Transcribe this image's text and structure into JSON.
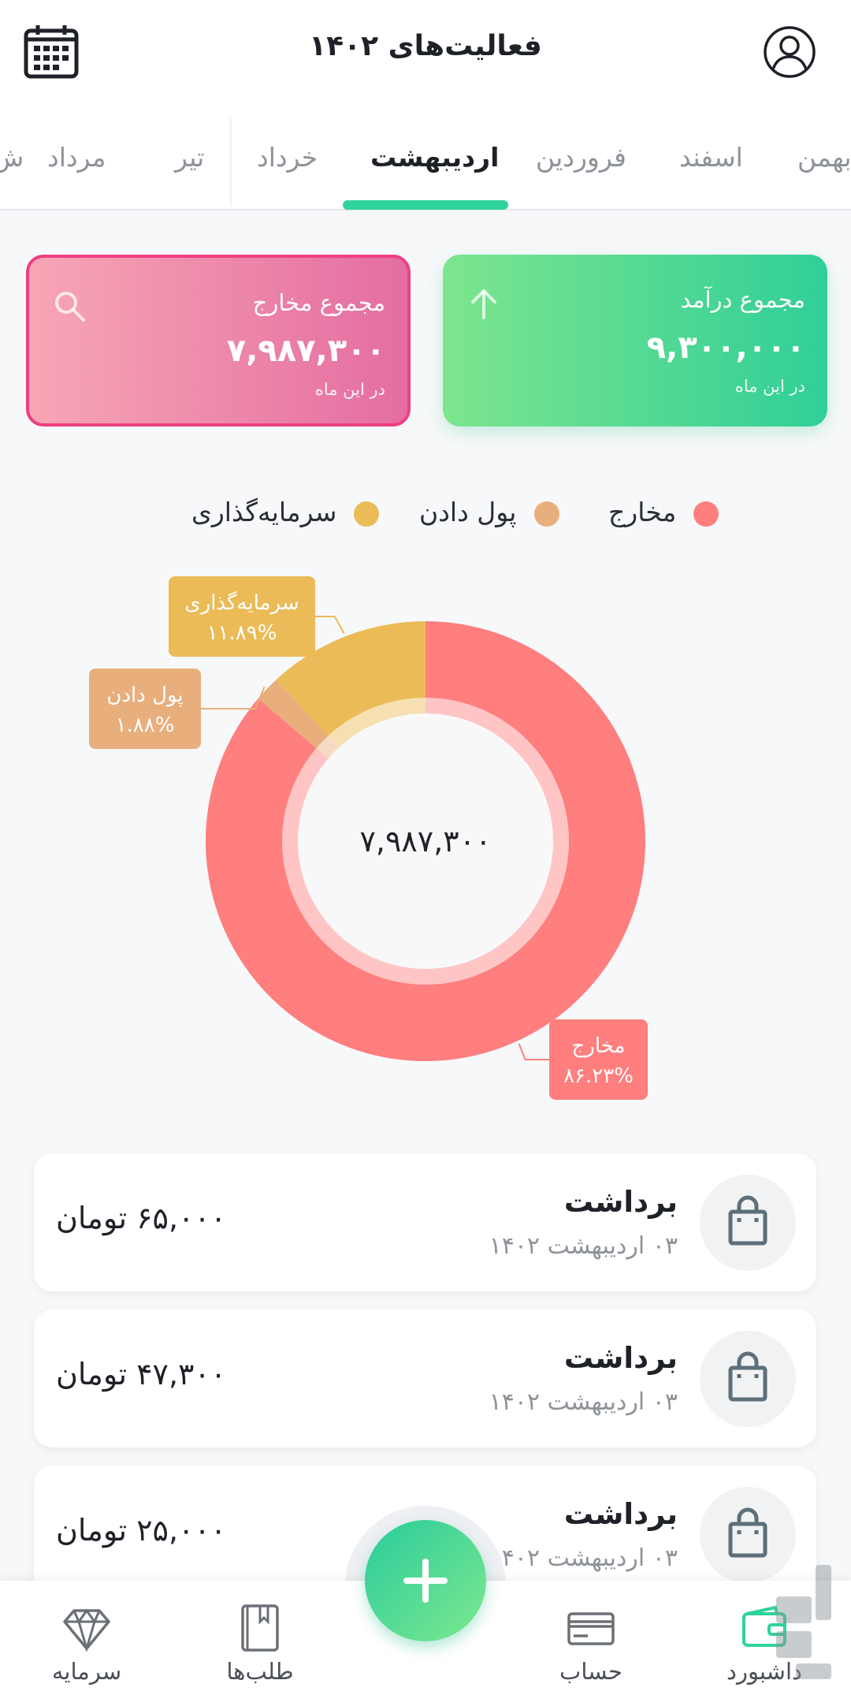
{
  "header": {
    "title": "فعالیت‌های ۱۴۰۲"
  },
  "tabs": [
    {
      "label": "بهمن",
      "active": false
    },
    {
      "label": "اسفند",
      "active": false
    },
    {
      "label": "فروردین",
      "active": false
    },
    {
      "label": "اردیبهشت",
      "active": true
    },
    {
      "label": "خرداد",
      "active": false
    },
    {
      "label": "تیر",
      "active": false
    },
    {
      "label": "مرداد",
      "active": false
    },
    {
      "label": "ش",
      "active": false
    }
  ],
  "summary": {
    "income": {
      "title": "مجموع درآمد",
      "amount": "۹,۳۰۰,۰۰۰",
      "sub": "در این ماه",
      "icon": "arrow-up-icon"
    },
    "expense": {
      "title": "مجموع مخارج",
      "amount": "۷,۹۸۷,۳۰۰",
      "sub": "در این ماه",
      "icon": "search-icon"
    }
  },
  "legend": [
    {
      "label": "مخارج",
      "color": "#ff7e7e"
    },
    {
      "label": "پول دادن",
      "color": "#e8ae7c"
    },
    {
      "label": "سرمایه‌گذاری",
      "color": "#eabb57"
    }
  ],
  "chart_data": {
    "type": "pie",
    "center_label": "۷,۹۸۷,۳۰۰",
    "slices": [
      {
        "label": "مخارج",
        "percent_label": "۸۶.۲۳%",
        "value": 86.23,
        "color": "#ff7e7e"
      },
      {
        "label": "پول دادن",
        "percent_label": "۱.۸۸%",
        "value": 1.88,
        "color": "#e8ae7c"
      },
      {
        "label": "سرمایه‌گذاری",
        "percent_label": "۱۱.۸۹%",
        "value": 11.89,
        "color": "#eabb57"
      }
    ]
  },
  "transactions": [
    {
      "title": "برداشت",
      "date": "۰۳ اردیبهشت ۱۴۰۲",
      "amount": "۶۵,۰۰۰ تومان",
      "icon": "shopping-bag-icon"
    },
    {
      "title": "برداشت",
      "date": "۰۳ اردیبهشت ۱۴۰۲",
      "amount": "۴۷,۳۰۰ تومان",
      "icon": "shopping-bag-icon"
    },
    {
      "title": "برداشت",
      "date": "۰۳ اردیبهشت ۱۴۰۲",
      "amount": "۲۵,۰۰۰ تومان",
      "icon": "shopping-bag-icon"
    }
  ],
  "nav": {
    "items": [
      {
        "label": "داشبورد",
        "icon": "wallet-icon",
        "active": true
      },
      {
        "label": "حساب",
        "icon": "credit-card-icon",
        "active": false
      },
      {
        "label": "طلب‌ها",
        "icon": "book-icon",
        "active": false
      },
      {
        "label": "سرمایه",
        "icon": "diamond-icon",
        "active": false
      }
    ],
    "fab_icon": "plus-icon"
  },
  "colors": {
    "accent": "#2fd39b",
    "income_start": "#7de58e",
    "income_end": "#30cf97",
    "expense_start": "#f7a6b5",
    "expense_end": "#e46da1",
    "expense_border": "#ef3f82"
  }
}
